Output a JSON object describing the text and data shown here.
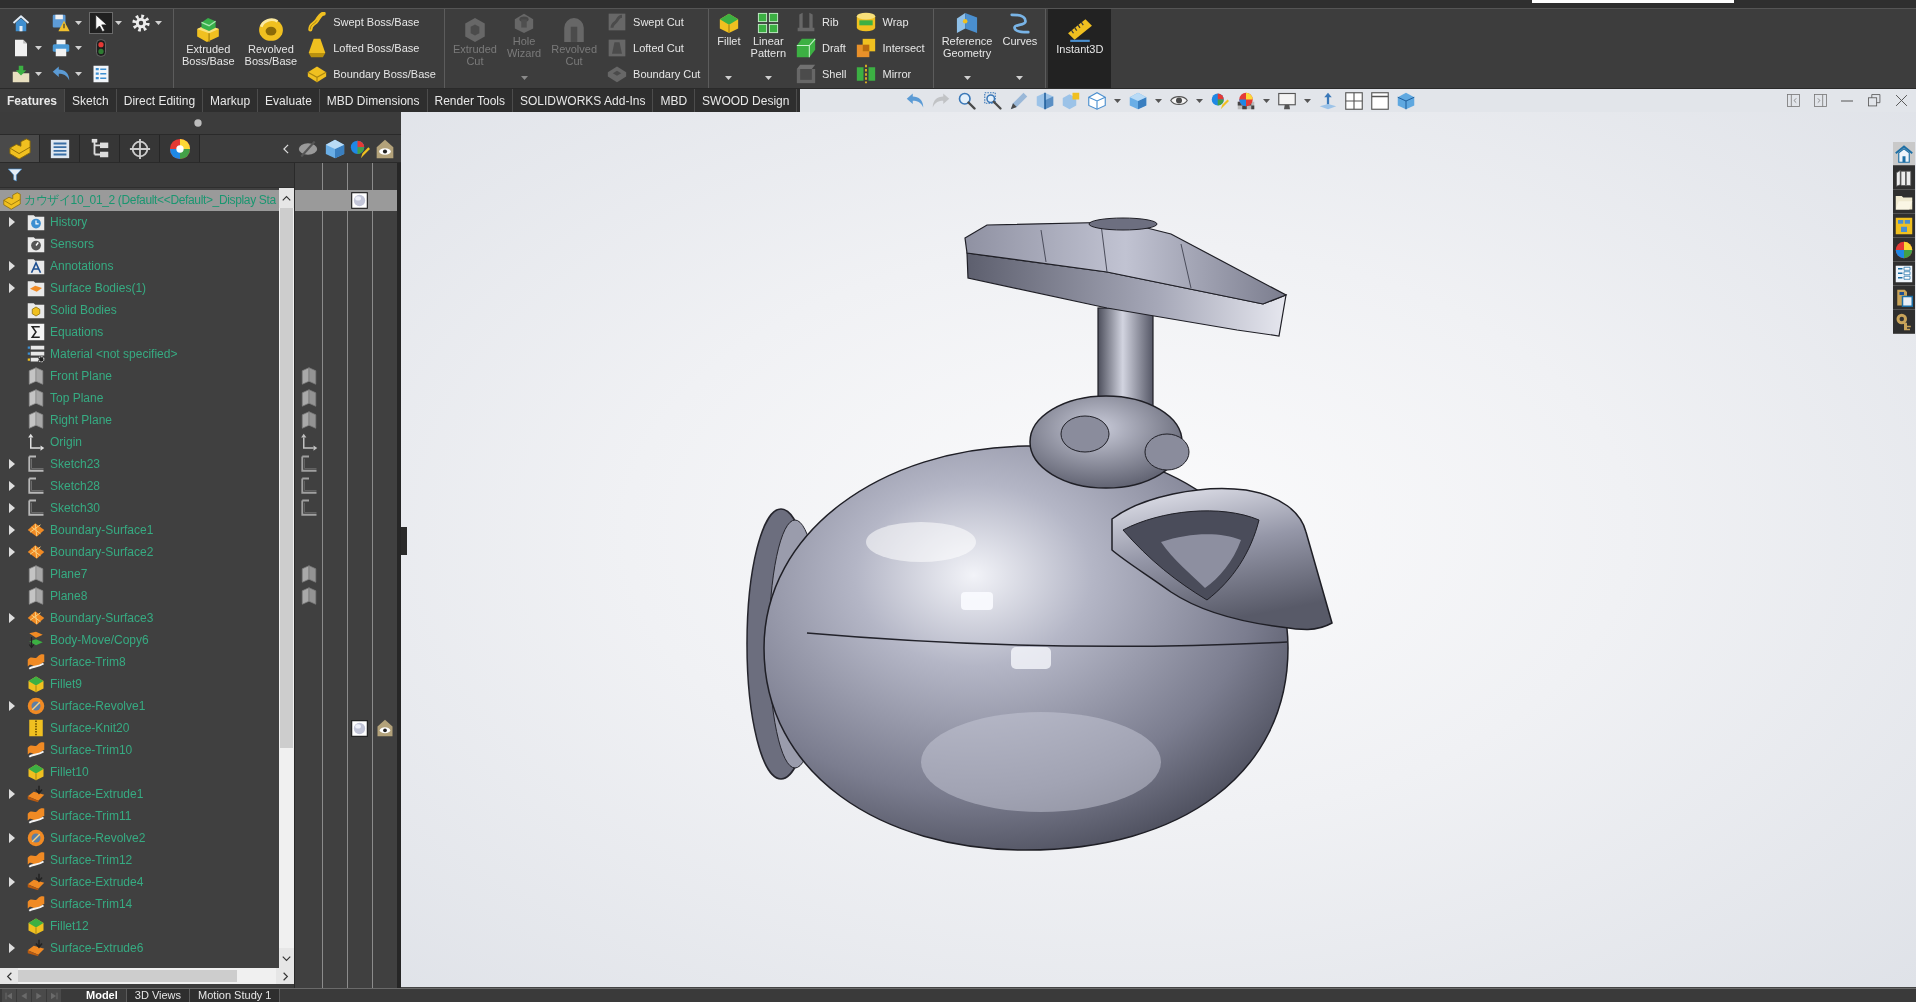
{
  "quick_access": [
    [
      {
        "kind": "home",
        "dropdown": false,
        "selected": false
      },
      {
        "kind": "new",
        "dropdown": true,
        "selected": false
      },
      {
        "kind": "open",
        "dropdown": true,
        "selected": false
      }
    ],
    [
      {
        "kind": "save",
        "dropdown": true,
        "selected": false
      },
      {
        "kind": "print",
        "dropdown": true,
        "selected": false
      },
      {
        "kind": "undo",
        "dropdown": true,
        "selected": false
      }
    ],
    [
      {
        "kind": "select",
        "dropdown": true,
        "selected": true
      },
      {
        "kind": "rebuild",
        "dropdown": false,
        "selected": false
      },
      {
        "kind": "fileprops",
        "dropdown": false,
        "selected": false
      }
    ],
    [
      {
        "kind": "options",
        "dropdown": true,
        "selected": false
      }
    ]
  ],
  "command_groups": [
    {
      "large_tools": [
        {
          "kind": "extrude",
          "label": "Extruded Boss/Base",
          "dropdown": false,
          "disabled": false,
          "on": false
        },
        {
          "kind": "revolve",
          "label": "Revolved Boss/Base",
          "dropdown": false,
          "disabled": false,
          "on": false
        }
      ],
      "stacks": [
        [
          {
            "kind": "sweep",
            "label": "Swept Boss/Base",
            "disabled": false
          },
          {
            "kind": "loft",
            "label": "Lofted Boss/Base",
            "disabled": false
          },
          {
            "kind": "boundary",
            "label": "Boundary Boss/Base",
            "disabled": false
          }
        ]
      ]
    },
    {
      "large_tools": [
        {
          "kind": "extrudecut",
          "label": "Extruded Cut",
          "dropdown": false,
          "disabled": true,
          "on": false
        },
        {
          "kind": "holewizard",
          "label": "Hole Wizard",
          "dropdown": true,
          "disabled": true,
          "on": false
        },
        {
          "kind": "revolvecut",
          "label": "Revolved Cut",
          "dropdown": false,
          "disabled": true,
          "on": false
        }
      ],
      "stacks": [
        [
          {
            "kind": "sweptcut",
            "label": "Swept Cut",
            "disabled": true
          },
          {
            "kind": "loftedcut",
            "label": "Lofted Cut",
            "disabled": true
          },
          {
            "kind": "boundarycut",
            "label": "Boundary Cut",
            "disabled": true
          }
        ]
      ]
    },
    {
      "large_tools": [
        {
          "kind": "fillet",
          "label": "Fillet",
          "dropdown": true,
          "disabled": false,
          "on": false
        },
        {
          "kind": "linearpattern",
          "label": "Linear Pattern",
          "dropdown": true,
          "disabled": false,
          "on": false
        }
      ],
      "stacks": [
        [
          {
            "kind": "rib",
            "label": "Rib",
            "disabled": true
          },
          {
            "kind": "draft",
            "label": "Draft",
            "disabled": false
          },
          {
            "kind": "shell",
            "label": "Shell",
            "disabled": true
          }
        ],
        [
          {
            "kind": "wrap",
            "label": "Wrap",
            "disabled": false
          },
          {
            "kind": "intersect",
            "label": "Intersect",
            "disabled": false
          },
          {
            "kind": "mirror",
            "label": "Mirror",
            "disabled": false
          }
        ]
      ]
    },
    {
      "large_tools": [
        {
          "kind": "refgeometry",
          "label": "Reference Geometry",
          "dropdown": true,
          "disabled": false,
          "on": false
        },
        {
          "kind": "curves",
          "label": "Curves",
          "dropdown": true,
          "disabled": false,
          "on": false
        }
      ]
    },
    {
      "large_tools": [
        {
          "kind": "instant3d",
          "label": "Instant3D",
          "dropdown": false,
          "disabled": false,
          "on": true
        }
      ]
    }
  ],
  "command_tabs": [
    {
      "label": "Features",
      "selected": true
    },
    {
      "label": "Sketch",
      "selected": false
    },
    {
      "label": "Direct Editing",
      "selected": false
    },
    {
      "label": "Markup",
      "selected": false
    },
    {
      "label": "Evaluate",
      "selected": false
    },
    {
      "label": "MBD Dimensions",
      "selected": false
    },
    {
      "label": "Render Tools",
      "selected": false
    },
    {
      "label": "SOLIDWORKS Add-Ins",
      "selected": false
    },
    {
      "label": "MBD",
      "selected": false
    },
    {
      "label": "SWOOD Design",
      "selected": false
    }
  ],
  "view_toolbar": [
    {
      "kind": "undo",
      "dropdown": false,
      "disabled": false
    },
    {
      "kind": "redo",
      "dropdown": false,
      "disabled": true
    },
    {
      "kind": "zoomfit",
      "dropdown": false,
      "disabled": false
    },
    {
      "kind": "zoomarea",
      "dropdown": false,
      "disabled": false
    },
    {
      "kind": "previousview",
      "dropdown": false,
      "disabled": false
    },
    {
      "kind": "section",
      "dropdown": false,
      "disabled": false
    },
    {
      "kind": "annotationviews",
      "dropdown": false,
      "disabled": false
    },
    {
      "kind": "vieworientation",
      "dropdown": true,
      "disabled": false
    },
    {
      "kind": "displaystyle",
      "dropdown": true,
      "disabled": false
    },
    {
      "kind": "hideshow",
      "dropdown": true,
      "disabled": false
    },
    {
      "kind": "editappearance",
      "dropdown": false,
      "disabled": false
    },
    {
      "kind": "applyscene",
      "dropdown": true,
      "disabled": false
    },
    {
      "kind": "viewsettings",
      "dropdown": true,
      "disabled": false
    },
    {
      "kind": "axis",
      "dropdown": false,
      "disabled": false
    },
    {
      "kind": "viewport",
      "dropdown": false,
      "disabled": false
    },
    {
      "kind": "window",
      "dropdown": false,
      "disabled": false
    },
    {
      "kind": "cube",
      "dropdown": false,
      "disabled": false
    }
  ],
  "window_controls": [
    {
      "kind": "tileleft"
    },
    {
      "kind": "tileright"
    },
    {
      "kind": "minimize"
    },
    {
      "kind": "restore"
    },
    {
      "kind": "close"
    }
  ],
  "feature_manager": {
    "panel_tabs": [
      {
        "kind": "featuremanager",
        "selected": true
      },
      {
        "kind": "propertymanager",
        "selected": false
      },
      {
        "kind": "configurationmanager",
        "selected": false
      },
      {
        "kind": "dimxpert",
        "selected": false
      },
      {
        "kind": "displaymanager",
        "selected": false
      }
    ],
    "display_columns": [
      {
        "kind": "hideshowcol"
      },
      {
        "kind": "displaymodecol"
      },
      {
        "kind": "appearancecol"
      },
      {
        "kind": "transparencycol"
      }
    ],
    "root": {
      "label": "カウザイ10_01_2 (Default<<Default>_Display Sta",
      "selected": true,
      "appearance": true
    },
    "items": [
      {
        "label": "History",
        "kind": "history",
        "expandable": true,
        "hide_show": false,
        "appearance": false,
        "transparency": false
      },
      {
        "label": "Sensors",
        "kind": "sensors",
        "expandable": false,
        "hide_show": false,
        "appearance": false,
        "transparency": false
      },
      {
        "label": "Annotations",
        "kind": "annotations",
        "expandable": true,
        "hide_show": false,
        "appearance": false,
        "transparency": false
      },
      {
        "label": "Surface Bodies(1)",
        "kind": "surfacebodies",
        "expandable": true,
        "hide_show": false,
        "appearance": false,
        "transparency": false
      },
      {
        "label": "Solid Bodies",
        "kind": "solidbodies",
        "expandable": false,
        "hide_show": false,
        "appearance": false,
        "transparency": false
      },
      {
        "label": "Equations",
        "kind": "equations",
        "expandable": false,
        "hide_show": false,
        "appearance": false,
        "transparency": false
      },
      {
        "label": "Material <not specified>",
        "kind": "material",
        "expandable": false,
        "hide_show": false,
        "appearance": false,
        "transparency": false
      },
      {
        "label": "Front Plane",
        "kind": "plane",
        "expandable": false,
        "hide_show": true,
        "appearance": false,
        "transparency": false
      },
      {
        "label": "Top Plane",
        "kind": "plane",
        "expandable": false,
        "hide_show": true,
        "appearance": false,
        "transparency": false
      },
      {
        "label": "Right Plane",
        "kind": "plane",
        "expandable": false,
        "hide_show": true,
        "appearance": false,
        "transparency": false
      },
      {
        "label": "Origin",
        "kind": "origin",
        "expandable": false,
        "hide_show": true,
        "appearance": false,
        "transparency": false
      },
      {
        "label": "Sketch23",
        "kind": "sketch",
        "expandable": true,
        "hide_show": true,
        "appearance": false,
        "transparency": false
      },
      {
        "label": "Sketch28",
        "kind": "sketch",
        "expandable": true,
        "hide_show": true,
        "appearance": false,
        "transparency": false
      },
      {
        "label": "Sketch30",
        "kind": "sketch",
        "expandable": true,
        "hide_show": true,
        "appearance": false,
        "transparency": false
      },
      {
        "label": "Boundary-Surface1",
        "kind": "boundarysurface",
        "expandable": true,
        "hide_show": false,
        "appearance": false,
        "transparency": false
      },
      {
        "label": "Boundary-Surface2",
        "kind": "boundarysurface",
        "expandable": true,
        "hide_show": false,
        "appearance": false,
        "transparency": false
      },
      {
        "label": "Plane7",
        "kind": "plane",
        "expandable": false,
        "hide_show": true,
        "appearance": false,
        "transparency": false
      },
      {
        "label": "Plane8",
        "kind": "plane",
        "expandable": false,
        "hide_show": true,
        "appearance": false,
        "transparency": false
      },
      {
        "label": "Boundary-Surface3",
        "kind": "boundarysurface",
        "expandable": true,
        "hide_show": false,
        "appearance": false,
        "transparency": false
      },
      {
        "label": "Body-Move/Copy6",
        "kind": "bodymovecopy",
        "expandable": false,
        "hide_show": false,
        "appearance": false,
        "transparency": false
      },
      {
        "label": "Surface-Trim8",
        "kind": "surfacetrim",
        "expandable": false,
        "hide_show": false,
        "appearance": false,
        "transparency": false
      },
      {
        "label": "Fillet9",
        "kind": "fillet",
        "expandable": false,
        "hide_show": false,
        "appearance": false,
        "transparency": false
      },
      {
        "label": "Surface-Revolve1",
        "kind": "surfacerevolve",
        "expandable": true,
        "hide_show": false,
        "appearance": false,
        "transparency": false
      },
      {
        "label": "Surface-Knit20",
        "kind": "surfaceknit",
        "expandable": false,
        "hide_show": false,
        "appearance": true,
        "transparency": true
      },
      {
        "label": "Surface-Trim10",
        "kind": "surfacetrim",
        "expandable": false,
        "hide_show": false,
        "appearance": false,
        "transparency": false
      },
      {
        "label": "Fillet10",
        "kind": "fillet",
        "expandable": false,
        "hide_show": false,
        "appearance": false,
        "transparency": false
      },
      {
        "label": "Surface-Extrude1",
        "kind": "surfaceextrude",
        "expandable": true,
        "hide_show": false,
        "appearance": false,
        "transparency": false
      },
      {
        "label": "Surface-Trim11",
        "kind": "surfacetrim",
        "expandable": false,
        "hide_show": false,
        "appearance": false,
        "transparency": false
      },
      {
        "label": "Surface-Revolve2",
        "kind": "surfacerevolve",
        "expandable": true,
        "hide_show": false,
        "appearance": false,
        "transparency": false
      },
      {
        "label": "Surface-Trim12",
        "kind": "surfacetrim",
        "expandable": false,
        "hide_show": false,
        "appearance": false,
        "transparency": false
      },
      {
        "label": "Surface-Extrude4",
        "kind": "surfaceextrude",
        "expandable": true,
        "hide_show": false,
        "appearance": false,
        "transparency": false
      },
      {
        "label": "Surface-Trim14",
        "kind": "surfacetrim",
        "expandable": false,
        "hide_show": false,
        "appearance": false,
        "transparency": false
      },
      {
        "label": "Fillet12",
        "kind": "fillet",
        "expandable": false,
        "hide_show": false,
        "appearance": false,
        "transparency": false
      },
      {
        "label": "Surface-Extrude6",
        "kind": "surfaceextrude",
        "expandable": true,
        "hide_show": false,
        "appearance": false,
        "transparency": false
      }
    ]
  },
  "task_pane": [
    {
      "kind": "resources",
      "selected": true
    },
    {
      "kind": "library",
      "selected": false
    },
    {
      "kind": "explorer",
      "selected": false
    },
    {
      "kind": "viewpalette",
      "selected": false
    },
    {
      "kind": "appearances",
      "selected": false
    },
    {
      "kind": "properties",
      "selected": false
    },
    {
      "kind": "tag",
      "selected": false
    },
    {
      "kind": "key",
      "selected": false
    }
  ],
  "model_tab_nav": [
    {
      "kind": "first",
      "disabled": true
    },
    {
      "kind": "previous",
      "disabled": true
    },
    {
      "kind": "next",
      "disabled": true
    },
    {
      "kind": "last",
      "disabled": true
    }
  ],
  "model_tabs": [
    {
      "label": "Model",
      "selected": true
    },
    {
      "label": "3D Views",
      "selected": false
    },
    {
      "label": "Motion Study 1",
      "selected": false
    }
  ]
}
